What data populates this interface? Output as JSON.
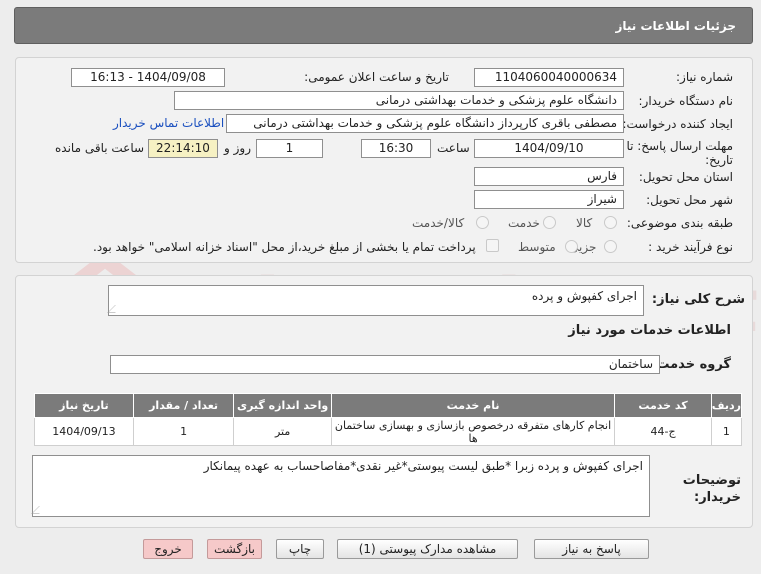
{
  "header": {
    "title": "جزئیات اطلاعات نیاز"
  },
  "watermark": {
    "text": "AriaTender.net"
  },
  "form": {
    "need_number_label": "شماره نیاز:",
    "need_number": "1104060040000634",
    "announce_label": "تاریخ و ساعت اعلان عمومی:",
    "announce_value": "1404/09/08 - 16:13",
    "buyer_org_label": "نام دستگاه خریدار:",
    "buyer_org": "دانشگاه علوم پزشکی و خدمات بهداشتی درمانی",
    "requester_label": "ایجاد کننده درخواست:",
    "requester": "مصطفی باقری کارپرداز دانشگاه علوم پزشکی و خدمات بهداشتی درمانی",
    "contact_link": "اطلاعات تماس خریدار",
    "deadline_label_1": "مهلت ارسال پاسخ: تا",
    "deadline_label_2": "تاریخ:",
    "deadline_date": "1404/09/10",
    "time_label": "ساعت",
    "deadline_time": "16:30",
    "days_value": "1",
    "days_label": "روز و",
    "remaining_value": "22:14:10",
    "remaining_label": "ساعت باقی مانده",
    "province_label": "استان محل تحویل:",
    "province": "فارس",
    "city_label": "شهر محل تحویل:",
    "city": "شیراز",
    "category_label": "طبقه بندی موضوعی:",
    "category_options": [
      "کالا",
      "خدمت",
      "کالا/خدمت"
    ],
    "process_label": "نوع فرآیند خرید :",
    "process_options": [
      "جزیی",
      "متوسط"
    ],
    "payment_note": "پرداخت تمام یا بخشی از مبلغ خرید،از محل \"اسناد خزانه اسلامی\" خواهد بود."
  },
  "details": {
    "summary_label": "شرح کلی نیاز:",
    "summary": "اجرای کفپوش و پرده",
    "services_heading": "اطلاعات خدمات مورد نیاز",
    "group_label": "گروه خدمت:",
    "group": "ساختمان",
    "table": {
      "headers": [
        "ردیف",
        "کد خدمت",
        "نام خدمت",
        "واحد اندازه گیری",
        "تعداد / مقدار",
        "تاریخ نیاز"
      ],
      "rows": [
        [
          "1",
          "ج-44",
          "انجام کارهای متفرقه درخصوص بازسازی و بهسازی ساختمان ها",
          "متر",
          "1",
          "1404/09/13"
        ]
      ]
    },
    "notes_label_1": "توضیحات",
    "notes_label_2": "خریدار:",
    "notes": "اجرای کفپوش و پرده زبرا *طبق لیست پیوستی*غیر نقدی*مفاصاحساب به عهده پیمانکار"
  },
  "buttons": {
    "reply": "پاسخ به نیاز",
    "attachments": "مشاهده مدارک پیوستی (1)",
    "print": "چاپ",
    "back": "بازگشت",
    "exit": "خروج"
  }
}
